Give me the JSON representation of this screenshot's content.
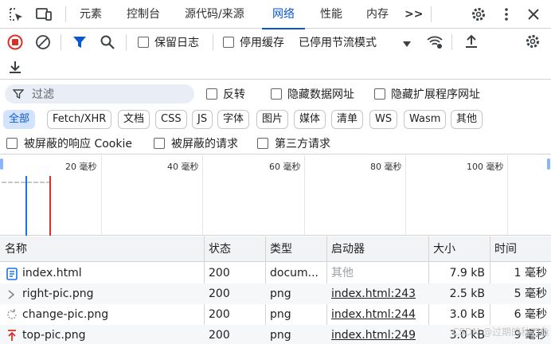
{
  "tabs": [
    "元素",
    "控制台",
    "源代码/来源",
    "网络",
    "性能",
    "内存"
  ],
  "more_tabs_label": ">>",
  "toolbar": {
    "preserve_log_label": "保留日志",
    "disable_cache_label": "停用缓存",
    "throttle_label": "已停用节流模式"
  },
  "filter": {
    "placeholder": "过滤",
    "invert_label": "反转",
    "hide_data_urls_label": "隐藏数据网址",
    "hide_ext_urls_label": "隐藏扩展程序网址"
  },
  "type_filters": [
    "全部",
    "Fetch/XHR",
    "文档",
    "CSS",
    "JS",
    "字体",
    "图片",
    "媒体",
    "清单",
    "WS",
    "Wasm",
    "其他"
  ],
  "row3": {
    "blocked_cookies_label": "被屏蔽的响应 Cookie",
    "blocked_requests_label": "被屏蔽的请求",
    "third_party_label": "第三方请求"
  },
  "timeline": {
    "ticks": [
      "20 毫秒",
      "40 毫秒",
      "60 毫秒",
      "80 毫秒",
      "100 毫秒"
    ],
    "dcl_color": "#1a73e8",
    "load_color": "#d93025"
  },
  "table": {
    "headers": [
      "名称",
      "状态",
      "类型",
      "启动器",
      "大小",
      "时间"
    ],
    "rows": [
      {
        "icon": "document-icon",
        "name": "index.html",
        "status": "200",
        "type": "docum...",
        "initiator": "其他",
        "size": "7.9 kB",
        "time": "1 毫秒"
      },
      {
        "icon": "chevron-right-icon",
        "name": "right-pic.png",
        "status": "200",
        "type": "png",
        "initiator": "index.html:243",
        "size": "2.5 kB",
        "time": "5 毫秒"
      },
      {
        "icon": "refresh-icon",
        "name": "change-pic.png",
        "status": "200",
        "type": "png",
        "initiator": "index.html:244",
        "size": "3.0 kB",
        "time": "6 毫秒"
      },
      {
        "icon": "arrow-up-icon",
        "name": "top-pic.png",
        "status": "200",
        "type": "png",
        "initiator": "index.html:249",
        "size": "3.0 kB",
        "time": "9 毫秒"
      }
    ]
  },
  "watermark": "CSDN @过期的秋刀鱼",
  "colors": {
    "accent": "#0b57d0",
    "record": "#d93025",
    "chip_active_bg": "#d3e3fd"
  }
}
